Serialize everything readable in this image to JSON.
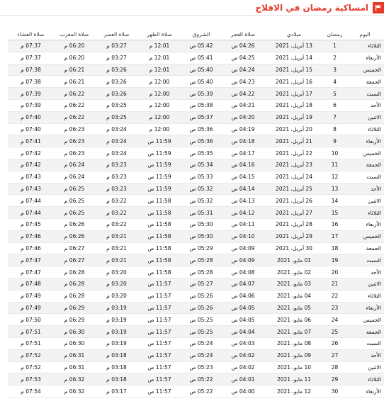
{
  "header": {
    "title": "امساكية رمضان في الافلاج",
    "icon": "flag-icon",
    "accent": "#e63a2b"
  },
  "columns": [
    "اليوم",
    "رمضان",
    "ميلادي",
    "صلاة الفجر",
    "الشروق",
    "صلاة الظهر",
    "صلاة العصر",
    "صلاة المغرب",
    "صلاة العشاء"
  ],
  "rows": [
    [
      "الثلاثاء",
      "1",
      "13 أبريل، 2021",
      "04:26 ص",
      "05:42 ص",
      "12:01 م",
      "03:27 م",
      "06:20 م",
      "07:37 م"
    ],
    [
      "الأربعاء",
      "2",
      "14 أبريل، 2021",
      "04:25 ص",
      "05:41 ص",
      "12:01 م",
      "03:27 م",
      "06:20 م",
      "07:37 م"
    ],
    [
      "الخميس",
      "3",
      "15 أبريل، 2021",
      "04:24 ص",
      "05:40 ص",
      "12:01 م",
      "03:26 م",
      "06:21 م",
      "07:38 م"
    ],
    [
      "الجمعة",
      "4",
      "16 أبريل، 2021",
      "04:23 ص",
      "05:40 ص",
      "12:00 م",
      "03:26 م",
      "06:21 م",
      "07:38 م"
    ],
    [
      "السبت",
      "5",
      "17 أبريل، 2021",
      "04:22 ص",
      "05:39 ص",
      "12:00 م",
      "03:26 م",
      "06:22 م",
      "07:39 م"
    ],
    [
      "الأحد",
      "6",
      "18 أبريل، 2021",
      "04:21 ص",
      "05:38 ص",
      "12:00 م",
      "03:25 م",
      "06:22 م",
      "07:39 م"
    ],
    [
      "الاثنين",
      "7",
      "19 أبريل، 2021",
      "04:20 ص",
      "05:37 ص",
      "12:00 م",
      "03:25 م",
      "06:22 م",
      "07:40 م"
    ],
    [
      "الثلاثاء",
      "8",
      "20 أبريل، 2021",
      "04:19 ص",
      "05:36 ص",
      "12:00 م",
      "03:24 م",
      "06:23 م",
      "07:40 م"
    ],
    [
      "الأربعاء",
      "9",
      "21 أبريل، 2021",
      "04:18 ص",
      "05:36 ص",
      "11:59 ص",
      "03:24 م",
      "06:23 م",
      "07:41 م"
    ],
    [
      "الخميس",
      "10",
      "22 أبريل، 2021",
      "04:17 ص",
      "05:35 ص",
      "11:59 ص",
      "03:24 م",
      "06:23 م",
      "07:42 م"
    ],
    [
      "الجمعة",
      "11",
      "23 أبريل، 2021",
      "04:16 ص",
      "05:34 ص",
      "11:59 ص",
      "03:23 م",
      "06:24 م",
      "07:42 م"
    ],
    [
      "السبت",
      "12",
      "24 أبريل، 2021",
      "04:15 ص",
      "05:33 ص",
      "11:59 ص",
      "03:23 م",
      "06:24 م",
      "07:43 م"
    ],
    [
      "الأحد",
      "13",
      "25 أبريل، 2021",
      "04:14 ص",
      "05:32 ص",
      "11:59 ص",
      "03:23 م",
      "06:25 م",
      "07:43 م"
    ],
    [
      "الاثنين",
      "14",
      "26 أبريل، 2021",
      "04:13 ص",
      "05:32 ص",
      "11:58 ص",
      "03:22 م",
      "06:25 م",
      "07:44 م"
    ],
    [
      "الثلاثاء",
      "15",
      "27 أبريل، 2021",
      "04:12 ص",
      "05:31 ص",
      "11:58 ص",
      "03:22 م",
      "06:25 م",
      "07:44 م"
    ],
    [
      "الأربعاء",
      "16",
      "28 أبريل، 2021",
      "04:11 ص",
      "05:30 ص",
      "11:58 ص",
      "03:22 م",
      "06:26 م",
      "07:45 م"
    ],
    [
      "الخميس",
      "17",
      "29 أبريل، 2021",
      "04:10 ص",
      "05:30 ص",
      "11:58 ص",
      "03:21 م",
      "06:26 م",
      "07:46 م"
    ],
    [
      "الجمعة",
      "18",
      "30 أبريل، 2021",
      "04:09 ص",
      "05:29 ص",
      "11:58 ص",
      "03:21 م",
      "06:27 م",
      "07:46 م"
    ],
    [
      "السبت",
      "19",
      "01 مايو، 2021",
      "04:09 ص",
      "05:28 ص",
      "11:58 ص",
      "03:21 م",
      "06:27 م",
      "07:47 م"
    ],
    [
      "الأحد",
      "20",
      "02 مايو، 2021",
      "04:08 ص",
      "05:28 ص",
      "11:58 ص",
      "03:20 م",
      "06:28 م",
      "07:47 م"
    ],
    [
      "الاثنين",
      "21",
      "03 مايو، 2021",
      "04:07 ص",
      "05:27 ص",
      "11:57 ص",
      "03:20 م",
      "06:28 م",
      "07:48 م"
    ],
    [
      "الثلاثاء",
      "22",
      "04 مايو، 2021",
      "04:06 ص",
      "05:26 ص",
      "11:57 ص",
      "03:20 م",
      "06:28 م",
      "07:49 م"
    ],
    [
      "الأربعاء",
      "23",
      "05 مايو، 2021",
      "04:05 ص",
      "05:26 ص",
      "11:57 ص",
      "03:19 م",
      "06:29 م",
      "07:49 م"
    ],
    [
      "الخميس",
      "24",
      "06 مايو، 2021",
      "04:05 ص",
      "05:25 ص",
      "11:57 ص",
      "03:19 م",
      "06:29 م",
      "07:50 م"
    ],
    [
      "الجمعة",
      "25",
      "07 مايو، 2021",
      "04:04 ص",
      "05:25 ص",
      "11:57 ص",
      "03:19 م",
      "06:30 م",
      "07:51 م"
    ],
    [
      "السبت",
      "26",
      "08 مايو، 2021",
      "04:03 ص",
      "05:24 ص",
      "11:57 ص",
      "03:19 م",
      "06:30 م",
      "07:51 م"
    ],
    [
      "الأحد",
      "27",
      "09 مايو، 2021",
      "04:02 ص",
      "05:24 ص",
      "11:57 ص",
      "03:18 م",
      "06:31 م",
      "07:52 م"
    ],
    [
      "الاثنين",
      "28",
      "10 مايو، 2021",
      "04:02 ص",
      "05:23 ص",
      "11:57 ص",
      "03:18 م",
      "06:31 م",
      "07:52 م"
    ],
    [
      "الثلاثاء",
      "29",
      "11 مايو، 2021",
      "04:01 ص",
      "05:22 ص",
      "11:57 ص",
      "03:18 م",
      "06:32 م",
      "07:53 م"
    ],
    [
      "الأربعاء",
      "30",
      "12 مايو، 2021",
      "04:00 ص",
      "05:22 ص",
      "11:57 ص",
      "03:17 م",
      "06:32 م",
      "07:54 م"
    ]
  ]
}
